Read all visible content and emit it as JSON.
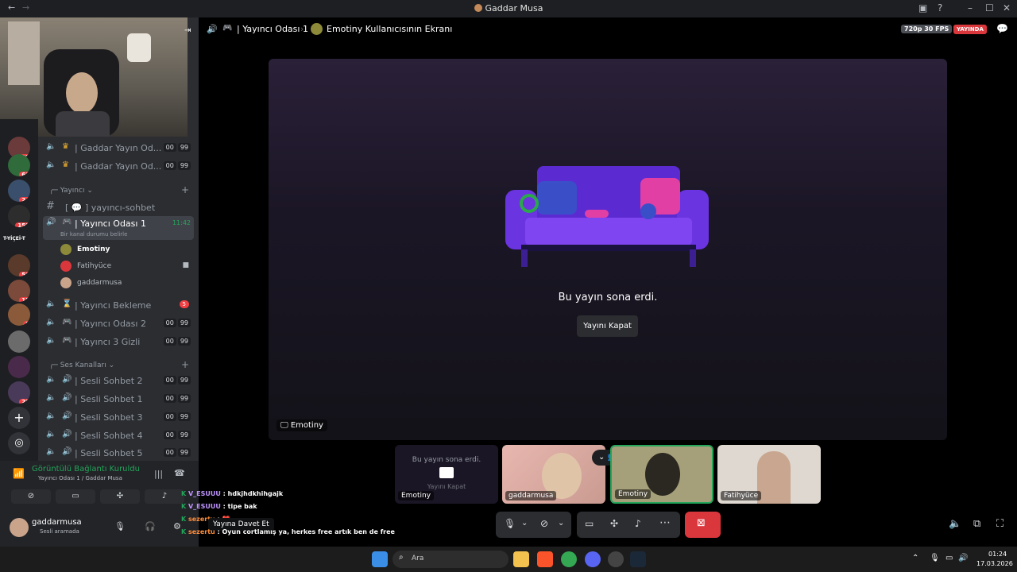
{
  "window": {
    "title": "Gaddar Musa"
  },
  "header": {
    "channel_name": "| Yayıncı Odası 1",
    "screen_title": "Emotiny Kullanıcısının Ekranı",
    "quality_badge": "720p 30 FPS",
    "live_badge": "YAYINDA"
  },
  "servers": [
    {
      "badge": "19"
    },
    {
      "badge": "66"
    },
    {
      "badge": "24"
    },
    {
      "badge": "150"
    },
    {
      "label": "T-YİÇEİ-T"
    },
    {
      "badge": "56"
    },
    {
      "badge": "15"
    },
    {
      "badge": "5"
    },
    {
      "badge": ""
    },
    {
      "badge": ""
    },
    {
      "badge": "20"
    }
  ],
  "channels": {
    "top": [
      {
        "name": "| Gaddar Yayın Od...",
        "count_a": "00",
        "count_b": "99"
      },
      {
        "name": "| Gaddar Yayın Od...",
        "count_a": "00",
        "count_b": "99"
      }
    ],
    "cat_yayinci": "Yayıncı",
    "text_channel": "[ 💬 ] yayıncı-sohbet",
    "active_channel": {
      "name": "| Yayıncı Odası 1",
      "time": "11:42",
      "status": "Bir kanal durumu belirle"
    },
    "users": [
      "Emotiny",
      "Fatihyüce",
      "gaddarmusa"
    ],
    "after": [
      {
        "name": "| Yayıncı Bekleme",
        "badge": "5"
      },
      {
        "name": "| Yayıncı Odası 2",
        "count_a": "00",
        "count_b": "99"
      },
      {
        "name": "| Yayıncı 3 Gizli",
        "count_a": "00",
        "count_b": "99"
      }
    ],
    "cat_ses": "Ses Kanalları",
    "voice": [
      {
        "name": "| Sesli Sohbet 2",
        "count_a": "00",
        "count_b": "99"
      },
      {
        "name": "| Sesli Sohbet 1",
        "count_a": "00",
        "count_b": "99"
      },
      {
        "name": "| Sesli Sohbet 3",
        "count_a": "00",
        "count_b": "99"
      },
      {
        "name": "| Sesli Sohbet 4",
        "count_a": "00",
        "count_b": "99"
      },
      {
        "name": "| Sesli Sohbet 5",
        "count_a": "00",
        "count_b": "99"
      }
    ]
  },
  "voice_panel": {
    "status": "Görüntülü Bağlantı Kuruldu",
    "location": "Yayıncı Odası 1 / Gaddar Musa",
    "username": "gaddarmusa",
    "user_status": "Sesli aramada"
  },
  "stage": {
    "ended_text": "Bu yayın sona erdi.",
    "close_button": "Yayını Kapat",
    "owner_label": "Emotiny"
  },
  "tiles": [
    {
      "label": "Emotiny",
      "overlay": "Bu yayın sona erdi.",
      "overlay_btn": "Yayını Kapat"
    },
    {
      "label": "gaddarmusa"
    },
    {
      "label": "Emotiny"
    },
    {
      "label": "Fatihyüce"
    }
  ],
  "chat_overlay": [
    {
      "user": "V_ESUUU",
      "msg": "hdkjhdkhihgajk"
    },
    {
      "user": "V_ESUUU",
      "msg": "tipe bak"
    },
    {
      "user": "sezertu",
      "msg": "❤️"
    },
    {
      "user": "sezertu",
      "msg": "Oyun cortlamış ya, herkes free artık ben de free"
    }
  ],
  "invite_tooltip": "Yayına Davet Et",
  "taskbar": {
    "search": "Ara",
    "time": "01:24",
    "date": "17.03.2026"
  },
  "colors": {
    "accent_green": "#23a55a",
    "danger": "#da373c",
    "live_red": "#da373c"
  }
}
